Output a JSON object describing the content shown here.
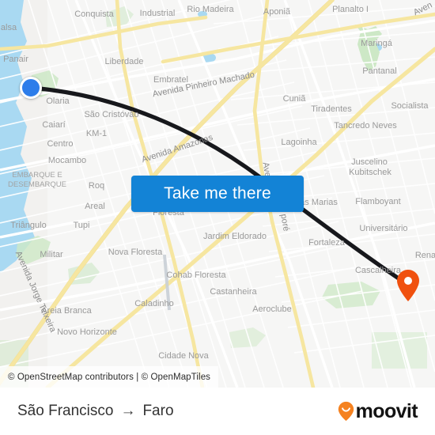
{
  "map": {
    "attribution": "© OpenStreetMap contributors | © OpenMapTiles",
    "origin_marker": "origin-dot",
    "destination_marker": "destination-pin",
    "colors": {
      "land": "#f2f1ef",
      "water": "#a9d9f2",
      "park": "#cde8c6",
      "road_major": "#f6e6a0",
      "road_minor": "#ffffff",
      "route_line": "#17181c",
      "origin": "#2d7dea",
      "destination": "#f0510f",
      "button": "#1383d6"
    },
    "place_labels": [
      "Conquista",
      "Industrial",
      "Rio Madeira",
      "Aponiã",
      "Planalto I",
      "alsa",
      "Liberdade",
      "Maringá",
      "Pantanal",
      "Embratel",
      "Panair",
      "Olaria",
      "Cuniã",
      "Tiradentes",
      "Socialista",
      "São Cristóvão",
      "Tancredo Neves",
      "Caiari",
      "KM-1",
      "Centro",
      "Lagoinha",
      "Mocambo",
      "Juscelino",
      "Kubitschek",
      "EMBARQUE E",
      "DESEMBARQUE",
      "Areal",
      "Roq",
      "ás Marias",
      "Flamboyant",
      "Floresta",
      "Universitário",
      "Triângulo",
      "Tupi",
      "Jardim Eldorado",
      "Fortaleza",
      "Militar",
      "Nova Floresta",
      "Cascalheira",
      "Rena",
      "Cohab Floresta",
      "Castanheira",
      "Areia Branca",
      "Caladinho",
      "Aeroclube",
      "Novo Horizonte",
      "Cidade Nova"
    ],
    "road_labels": [
      "Avenida Pinheiro Machado",
      "Avenida Amazonas",
      "Avenida Jorge Teixeira",
      "Avenida Guaporé",
      "Aven"
    ]
  },
  "cta": {
    "label": "Take me there"
  },
  "footer": {
    "origin": "São Francisco",
    "arrow": "→",
    "destination": "Faro",
    "brand": "moovit"
  }
}
